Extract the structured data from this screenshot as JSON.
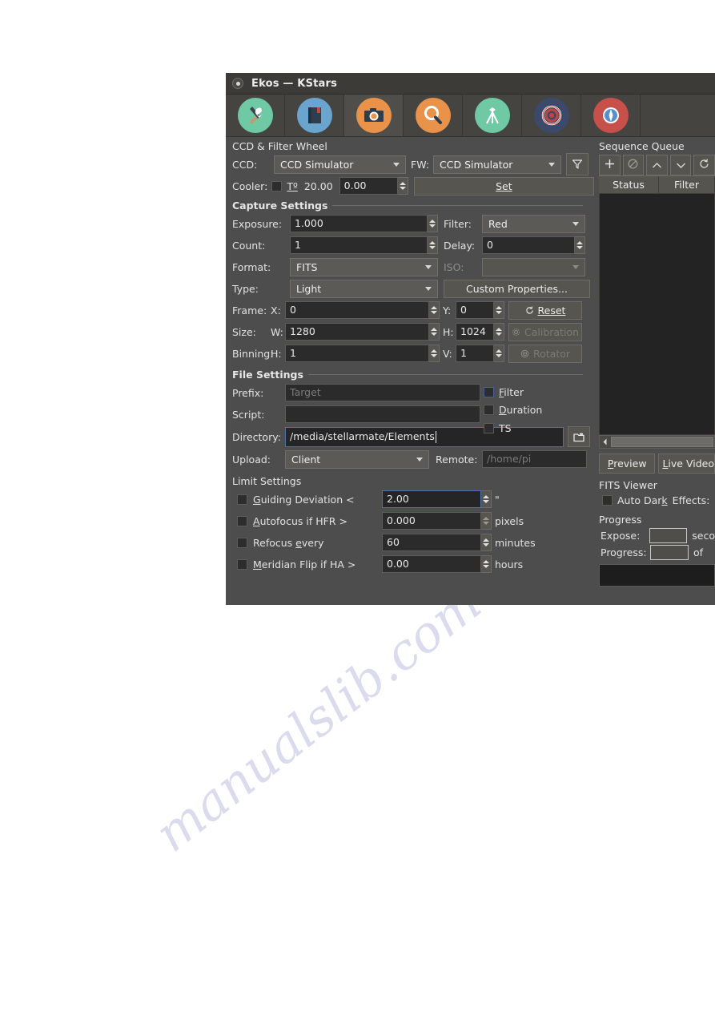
{
  "window": {
    "title": "Ekos — KStars",
    "title_icon": "app-dot-icon"
  },
  "tabs": [
    {
      "name": "setup",
      "icon": "tools-icon",
      "bg": "#6ec9a4",
      "active": false
    },
    {
      "name": "logs",
      "icon": "book-icon",
      "bg": "#6aa5cf",
      "active": false
    },
    {
      "name": "capture",
      "icon": "camera-icon",
      "bg": "#e8924a",
      "active": true
    },
    {
      "name": "focus",
      "icon": "magnifier-icon",
      "bg": "#e8924a",
      "active": false
    },
    {
      "name": "mount",
      "icon": "tripod-icon",
      "bg": "#6ec9a4",
      "active": false
    },
    {
      "name": "guide",
      "icon": "target-icon",
      "bg": "#3b4a6b",
      "active": false
    },
    {
      "name": "align",
      "icon": "compass-icon",
      "bg": "#c8504a",
      "active": false
    }
  ],
  "ccd_filter_wheel": {
    "group_title": "CCD & Filter Wheel",
    "ccd_label": "CCD:",
    "ccd_value": "CCD Simulator",
    "fw_label": "FW:",
    "fw_value": "CCD Simulator",
    "filter_icon": "funnel-icon",
    "cooler_label": "Cooler:",
    "temp_label": "Tº",
    "temp_current": "20.00",
    "temp_target": "0.00",
    "set_button": "Set"
  },
  "capture_settings": {
    "group_title": "Capture Settings",
    "exposure_label": "Exposure:",
    "exposure_value": "1.000",
    "filter_label": "Filter:",
    "filter_value": "Red",
    "count_label": "Count:",
    "count_value": "1",
    "delay_label": "Delay:",
    "delay_value": "0",
    "format_label": "Format:",
    "format_value": "FITS",
    "iso_label": "ISO:",
    "iso_value": "",
    "type_label": "Type:",
    "type_value": "Light",
    "custom_properties_button": "Custom Properties...",
    "frame_label": "Frame:",
    "frame_x_label": "X:",
    "frame_x_value": "0",
    "frame_y_label": "Y:",
    "frame_y_value": "0",
    "reset_button": "Reset",
    "reset_icon": "reset-icon",
    "size_label": "Size:",
    "size_w_label": "W:",
    "size_w_value": "1280",
    "size_h_label": "H:",
    "size_h_value": "1024",
    "calibration_button": "Calibration",
    "calibration_icon": "gear-icon",
    "binning_label": "Binning:",
    "binning_h_label": "H:",
    "binning_h_value": "1",
    "binning_v_label": "V:",
    "binning_v_value": "1",
    "rotator_button": "Rotator",
    "rotator_icon": "rotator-icon"
  },
  "file_settings": {
    "group_title": "File Settings",
    "prefix_label": "Prefix:",
    "prefix_placeholder": "Target",
    "prefix_value": "",
    "filter_check": "Filter",
    "duration_check": "Duration",
    "ts_check": "TS",
    "script_label": "Script:",
    "script_value": "",
    "directory_label": "Directory:",
    "directory_value": "/media/stellarmate/Elements",
    "browse_icon": "folder-icon",
    "upload_label": "Upload:",
    "upload_value": "Client",
    "remote_label": "Remote:",
    "remote_placeholder": "/home/pi"
  },
  "limit_settings": {
    "group_title": "Limit Settings",
    "rows": [
      {
        "label": "Guiding Deviation <",
        "value": "2.00",
        "unit": "\"",
        "checked": false
      },
      {
        "label": "Autofocus if HFR >",
        "value": "0.000",
        "unit": "pixels",
        "checked": false
      },
      {
        "label": "Refocus every",
        "value": "60",
        "unit": "minutes",
        "checked": false
      },
      {
        "label": "Meridian Flip if HA >",
        "value": "0.00",
        "unit": "hours",
        "checked": false
      }
    ]
  },
  "sequence_queue": {
    "group_title": "Sequence Queue",
    "buttons": [
      {
        "name": "add-job-button",
        "icon": "plus-icon"
      },
      {
        "name": "remove-job-button",
        "icon": "forbidden-icon"
      },
      {
        "name": "move-up-button",
        "icon": "chevron-up-icon"
      },
      {
        "name": "move-down-button",
        "icon": "chevron-down-icon"
      },
      {
        "name": "reset-job-button",
        "icon": "reset-icon"
      }
    ],
    "columns": [
      "Status",
      "Filter"
    ],
    "rows": [],
    "preview_button": "Preview",
    "live_video_button": "Live Video"
  },
  "fits_viewer": {
    "group_title": "FITS Viewer",
    "auto_dark_check": "Auto Dark",
    "effects_label": "Effects:"
  },
  "progress": {
    "group_title": "Progress",
    "expose_label": "Expose:",
    "expose_value": "",
    "expose_unit": "seco",
    "progress_label": "Progress:",
    "progress_value": "",
    "progress_of": "of"
  },
  "watermark": {
    "line1": "manualslib.com",
    "line2": "manualslib.com"
  }
}
